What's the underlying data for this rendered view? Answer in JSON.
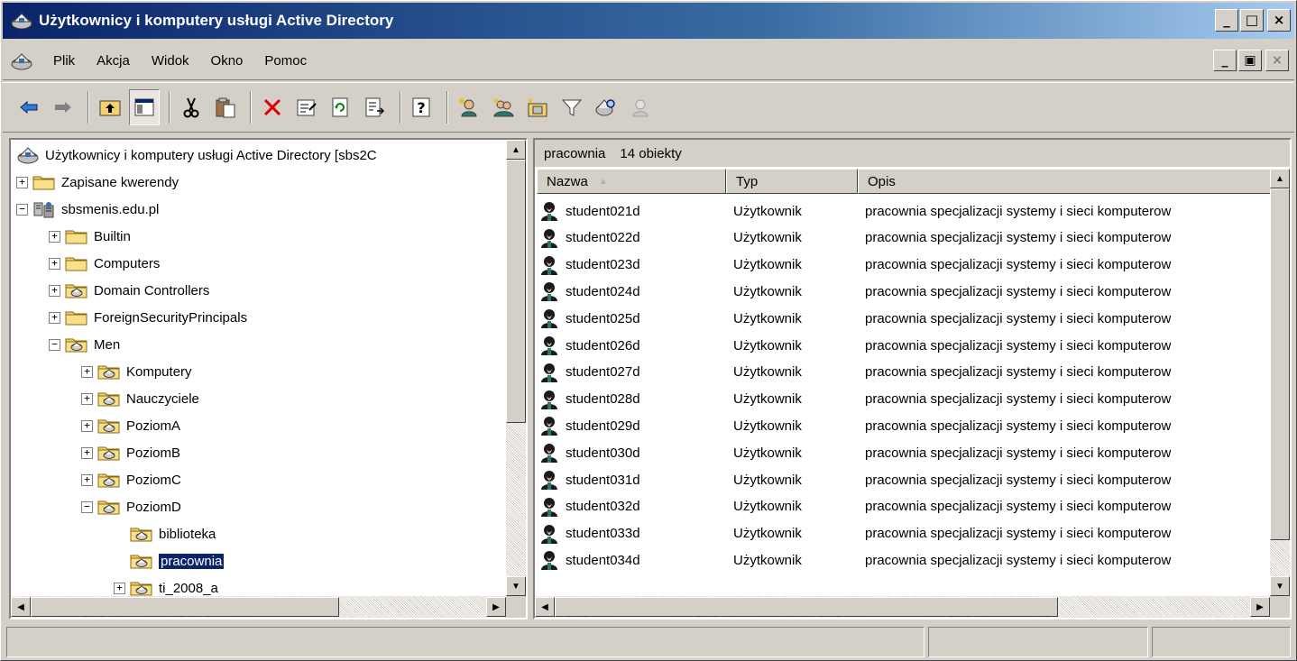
{
  "window": {
    "title": "Użytkownicy i komputery usługi Active Directory",
    "title_buttons": {
      "minimize": "_",
      "maximize": "□",
      "close": "×"
    }
  },
  "menu": {
    "items": [
      "Plik",
      "Akcja",
      "Widok",
      "Okno",
      "Pomoc"
    ],
    "mdi_buttons": {
      "minimize": "_",
      "restore": "▣",
      "close": "×"
    }
  },
  "toolbar": {
    "icons": [
      "back-arrow-icon",
      "forward-arrow-icon",
      "up-folder-icon",
      "show-hide-tree-icon",
      "cut-icon",
      "paste-icon",
      "delete-icon",
      "properties-icon",
      "refresh-icon",
      "export-list-icon",
      "help-icon",
      "new-user-icon",
      "new-group-icon",
      "new-ou-icon",
      "filter-icon",
      "find-icon",
      "add-to-group-icon"
    ]
  },
  "tree": {
    "nodes": [
      {
        "label": "Użytkownicy i komputery usługi Active Directory [sbs2C",
        "level": 0,
        "expander": "",
        "icon": "ad-root-icon"
      },
      {
        "label": "Zapisane kwerendy",
        "level": 1,
        "expander": "+",
        "icon": "folder-icon"
      },
      {
        "label": "sbsmenis.edu.pl",
        "level": 1,
        "expander": "−",
        "icon": "domain-icon"
      },
      {
        "label": "Builtin",
        "level": 2,
        "expander": "+",
        "icon": "folder-icon"
      },
      {
        "label": "Computers",
        "level": 2,
        "expander": "+",
        "icon": "folder-icon"
      },
      {
        "label": "Domain Controllers",
        "level": 2,
        "expander": "+",
        "icon": "ou-icon"
      },
      {
        "label": "ForeignSecurityPrincipals",
        "level": 2,
        "expander": "+",
        "icon": "folder-icon"
      },
      {
        "label": "Men",
        "level": 2,
        "expander": "−",
        "icon": "ou-icon"
      },
      {
        "label": "Komputery",
        "level": 3,
        "expander": "+",
        "icon": "ou-icon"
      },
      {
        "label": "Nauczyciele",
        "level": 3,
        "expander": "+",
        "icon": "ou-icon"
      },
      {
        "label": "PoziomA",
        "level": 3,
        "expander": "+",
        "icon": "ou-icon"
      },
      {
        "label": "PoziomB",
        "level": 3,
        "expander": "+",
        "icon": "ou-icon"
      },
      {
        "label": "PoziomC",
        "level": 3,
        "expander": "+",
        "icon": "ou-icon"
      },
      {
        "label": "PoziomD",
        "level": 3,
        "expander": "−",
        "icon": "ou-icon"
      },
      {
        "label": "biblioteka",
        "level": 4,
        "expander": "",
        "icon": "ou-icon"
      },
      {
        "label": "pracownia",
        "level": 4,
        "expander": "",
        "icon": "ou-icon",
        "selected": true
      },
      {
        "label": "ti_2008_a",
        "level": 4,
        "expander": "+",
        "icon": "ou-icon"
      }
    ]
  },
  "list": {
    "container": "pracownia",
    "count": "14 obiekty",
    "columns": [
      "Nazwa",
      "Typ",
      "Opis"
    ],
    "rows": [
      {
        "name": "student021d",
        "type": "Użytkownik",
        "desc": "pracownia specjalizacji systemy i sieci komputerow"
      },
      {
        "name": "student022d",
        "type": "Użytkownik",
        "desc": "pracownia specjalizacji systemy i sieci komputerow"
      },
      {
        "name": "student023d",
        "type": "Użytkownik",
        "desc": "pracownia specjalizacji systemy i sieci komputerow"
      },
      {
        "name": "student024d",
        "type": "Użytkownik",
        "desc": "pracownia specjalizacji systemy i sieci komputerow"
      },
      {
        "name": "student025d",
        "type": "Użytkownik",
        "desc": "pracownia specjalizacji systemy i sieci komputerow"
      },
      {
        "name": "student026d",
        "type": "Użytkownik",
        "desc": "pracownia specjalizacji systemy i sieci komputerow"
      },
      {
        "name": "student027d",
        "type": "Użytkownik",
        "desc": "pracownia specjalizacji systemy i sieci komputerow"
      },
      {
        "name": "student028d",
        "type": "Użytkownik",
        "desc": "pracownia specjalizacji systemy i sieci komputerow"
      },
      {
        "name": "student029d",
        "type": "Użytkownik",
        "desc": "pracownia specjalizacji systemy i sieci komputerow"
      },
      {
        "name": "student030d",
        "type": "Użytkownik",
        "desc": "pracownia specjalizacji systemy i sieci komputerow"
      },
      {
        "name": "student031d",
        "type": "Użytkownik",
        "desc": "pracownia specjalizacji systemy i sieci komputerow"
      },
      {
        "name": "student032d",
        "type": "Użytkownik",
        "desc": "pracownia specjalizacji systemy i sieci komputerow"
      },
      {
        "name": "student033d",
        "type": "Użytkownik",
        "desc": "pracownia specjalizacji systemy i sieci komputerow"
      },
      {
        "name": "student034d",
        "type": "Użytkownik",
        "desc": "pracownia specjalizacji systemy i sieci komputerow"
      }
    ]
  },
  "colors": {
    "title_start": "#0a246a",
    "title_end": "#a6caf0",
    "selection": "#0a246a",
    "face": "#d4d0c8",
    "folder": "#f3d26b",
    "delete_red": "#e00000"
  }
}
